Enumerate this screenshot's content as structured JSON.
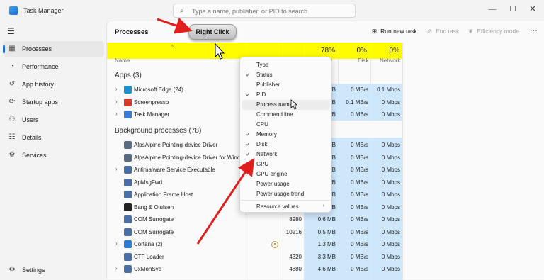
{
  "window": {
    "title": "Task Manager",
    "search_placeholder": "Type a name, publisher, or PID to search",
    "controls": {
      "minimize": "—",
      "maximize": "☐",
      "close": "✕"
    }
  },
  "sidebar": {
    "menu_icon": "☰",
    "items": [
      {
        "label": "Processes",
        "icon": "processes-icon",
        "glyph": "▦",
        "active": true
      },
      {
        "label": "Performance",
        "icon": "performance-icon",
        "glyph": "◔"
      },
      {
        "label": "App history",
        "icon": "history-icon",
        "glyph": "↺"
      },
      {
        "label": "Startup apps",
        "icon": "startup-icon",
        "glyph": "⟳"
      },
      {
        "label": "Users",
        "icon": "users-icon",
        "glyph": "⚇"
      },
      {
        "label": "Details",
        "icon": "details-icon",
        "glyph": "☷"
      },
      {
        "label": "Services",
        "icon": "services-icon",
        "glyph": "⚙"
      }
    ],
    "settings": {
      "label": "Settings",
      "glyph": "⚙"
    }
  },
  "toolbar": {
    "title": "Processes",
    "run_new_task": "Run new task",
    "end_task": "End task",
    "efficiency_mode": "Efficiency mode",
    "more": "⋯"
  },
  "header": {
    "sort_arrow": "^",
    "percentages": {
      "memory": "78%",
      "disk": "0%",
      "network": "0%"
    },
    "columns": {
      "name": "Name",
      "memory": "y",
      "disk": "Disk",
      "network": "Network"
    }
  },
  "annotation": {
    "callout": "Right Click"
  },
  "sections": {
    "apps": "Apps (3)",
    "background": "Background processes (78)"
  },
  "apps": [
    {
      "name": "Microsoft Edge (24)",
      "icon_color": "#1f8fcf",
      "expand": true,
      "mem": "MB",
      "disk": "0 MB/s",
      "net": "0.1 Mbps"
    },
    {
      "name": "Screenpresso",
      "icon_color": "#d93a2b",
      "expand": true,
      "mem": "MB",
      "disk": "0.1 MB/s",
      "net": "0 Mbps"
    },
    {
      "name": "Task Manager",
      "icon_color": "#3a7bd5",
      "expand": true,
      "mem": "MB",
      "disk": "0 MB/s",
      "net": "0 Mbps"
    }
  ],
  "background": [
    {
      "name": "AlpsAlpine Pointing-device Driver",
      "icon_color": "#5a6a82",
      "expand": false,
      "pid": "",
      "mem": "MB",
      "disk": "0 MB/s",
      "net": "0 Mbps"
    },
    {
      "name": "AlpsAlpine Pointing-device Driver for Windo...",
      "icon_color": "#5a6a82",
      "expand": false,
      "pid": "",
      "mem": "MB",
      "disk": "0 MB/s",
      "net": "0 Mbps"
    },
    {
      "name": "Antimalware Service Executable",
      "icon_color": "#4a6fa5",
      "expand": true,
      "pid": "",
      "mem": "MB",
      "disk": "0 MB/s",
      "net": "0 Mbps"
    },
    {
      "name": "ApMsgFwd",
      "icon_color": "#4a6fa5",
      "expand": false,
      "pid": "",
      "mem": "MB",
      "disk": "0 MB/s",
      "net": "0 Mbps"
    },
    {
      "name": "Application Frame Host",
      "icon_color": "#4a6fa5",
      "expand": false,
      "pid": "",
      "mem": "MB",
      "disk": "0 MB/s",
      "net": "0 Mbps"
    },
    {
      "name": "Bang & Olufsen",
      "icon_color": "#222222",
      "expand": false,
      "pid": "",
      "mem": "MB",
      "disk": "0 MB/s",
      "net": "0 Mbps"
    },
    {
      "name": "COM Surrogate",
      "icon_color": "#4a6fa5",
      "expand": false,
      "pid": "8980",
      "mem": "0.6 MB",
      "disk": "0 MB/s",
      "net": "0 Mbps"
    },
    {
      "name": "COM Surrogate",
      "icon_color": "#4a6fa5",
      "expand": false,
      "pid": "10216",
      "mem": "0.5 MB",
      "disk": "0 MB/s",
      "net": "0 Mbps"
    },
    {
      "name": "Cortana (2)",
      "icon_color": "#2a7fd4",
      "expand": true,
      "pid": "",
      "mem": "1.3 MB",
      "disk": "0 MB/s",
      "net": "0 Mbps",
      "paused": true,
      "pause_glyph": "⏸"
    },
    {
      "name": "CTF Loader",
      "icon_color": "#4a6fa5",
      "expand": false,
      "pid": "4320",
      "mem": "3.3 MB",
      "disk": "0 MB/s",
      "net": "0 Mbps"
    },
    {
      "name": "CxMonSvc",
      "icon_color": "#4a6fa5",
      "expand": true,
      "pid": "4880",
      "mem": "4.6 MB",
      "disk": "0 MB/s",
      "net": "0 Mbps"
    }
  ],
  "context_menu": {
    "items": [
      {
        "label": "Type",
        "checked": false
      },
      {
        "label": "Status",
        "checked": true
      },
      {
        "label": "Publisher",
        "checked": false
      },
      {
        "label": "PID",
        "checked": true
      },
      {
        "label": "Process name",
        "checked": false,
        "hover": true
      },
      {
        "label": "Command line",
        "checked": false
      },
      {
        "label": "CPU",
        "checked": false
      },
      {
        "label": "Memory",
        "checked": true
      },
      {
        "label": "Disk",
        "checked": true
      },
      {
        "label": "Network",
        "checked": true
      },
      {
        "label": "GPU",
        "checked": false
      },
      {
        "label": "GPU engine",
        "checked": false
      },
      {
        "label": "Power usage",
        "checked": false
      },
      {
        "label": "Power usage trend",
        "checked": false
      }
    ],
    "submenu": {
      "label": "Resource values",
      "arrow": "›"
    },
    "check_glyph": "✓"
  },
  "colors": {
    "highlight": "#fffb00",
    "column_tint": "#cfe7fb",
    "arrow": "#e01e1e",
    "accent": "#1e6fd6"
  }
}
